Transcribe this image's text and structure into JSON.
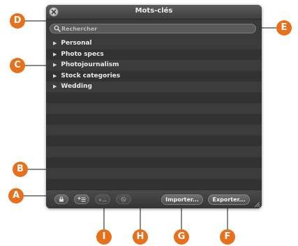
{
  "window": {
    "title": "Mots-clés",
    "close_icon": "close-circle-icon"
  },
  "search": {
    "placeholder": "Rechercher",
    "value": "",
    "icon": "magnifier-icon"
  },
  "keywords": [
    {
      "label": "Personal"
    },
    {
      "label": "Photo specs"
    },
    {
      "label": "Photojournalism"
    },
    {
      "label": "Stock categories"
    },
    {
      "label": "Wedding"
    }
  ],
  "toolbar": {
    "lock_icon": "lock-icon",
    "add_keyword_icon": "add-keyword-icon",
    "add_subkeyword_icon": "add-child-keyword-icon",
    "remove_icon": "remove-icon",
    "import_label": "Importer...",
    "export_label": "Exporter..."
  },
  "callouts": {
    "A": "A",
    "B": "B",
    "C": "C",
    "D": "D",
    "E": "E",
    "F": "F",
    "G": "G",
    "H": "H",
    "I": "I"
  },
  "colors": {
    "callout": "#e8701a",
    "panel": "#3a3a3a",
    "row_text": "#eaeaea"
  }
}
